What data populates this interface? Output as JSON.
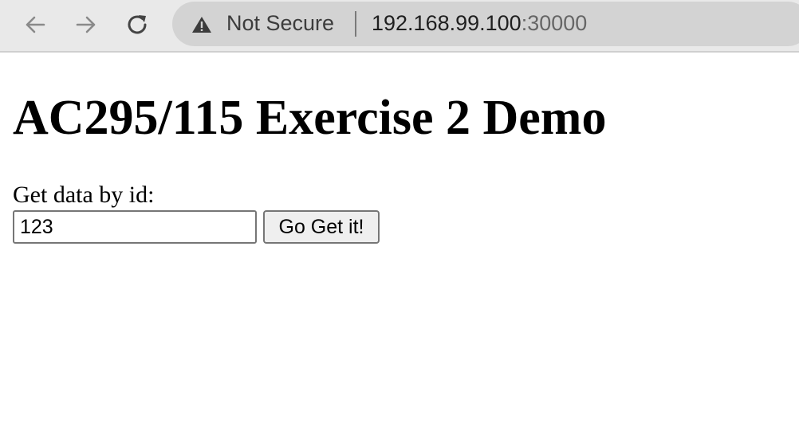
{
  "browser": {
    "nav": {
      "back_icon": "arrow-left-icon",
      "forward_icon": "arrow-right-icon",
      "reload_icon": "reload-icon"
    },
    "omnibox": {
      "security_icon": "warning-triangle-icon",
      "security_label": "Not Secure",
      "url_host": "192.168.99.100",
      "url_port": ":30000"
    }
  },
  "page": {
    "title": "AC295/115 Exercise 2 Demo",
    "form": {
      "label": "Get data by id:",
      "id_value": "123",
      "submit_label": "Go Get it!"
    }
  },
  "colors": {
    "toolbar_bg": "#e9e9e9",
    "omnibox_bg": "#d3d3d3",
    "page_bg": "#ffffff"
  }
}
